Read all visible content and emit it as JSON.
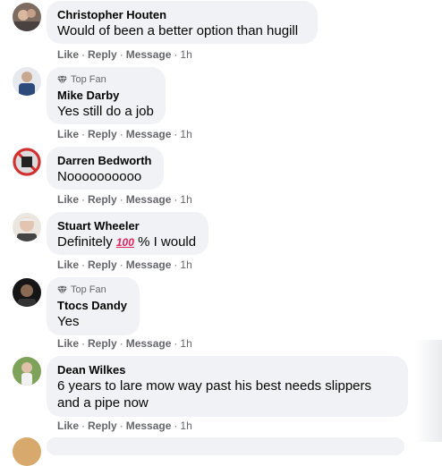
{
  "comments": [
    {
      "author": "Christopher Houten",
      "text": "Would of been a better option than hugill",
      "top_fan": false,
      "like": "Like",
      "reply": "Reply",
      "message": "Message",
      "time": "1h",
      "avatar_color": "#8a6a55"
    },
    {
      "author": "Mike Darby",
      "text": "Yes still do a job",
      "top_fan": true,
      "badge_label": "Top Fan",
      "like": "Like",
      "reply": "Reply",
      "message": "Message",
      "time": "1h",
      "avatar_color": "#3b5f86"
    },
    {
      "author": "Darren Bedworth",
      "text": "Noooooooooo",
      "top_fan": false,
      "like": "Like",
      "reply": "Reply",
      "message": "Message",
      "time": "1h",
      "avatar_color": "#2a2a2a"
    },
    {
      "author": "Stuart Wheeler",
      "text_before": "Definitely",
      "emoji": "100",
      "text_after": "% I would",
      "top_fan": false,
      "like": "Like",
      "reply": "Reply",
      "message": "Message",
      "time": "1h",
      "avatar_color": "#b9a89a"
    },
    {
      "author": "Ttocs Dandy",
      "text": "Yes",
      "top_fan": true,
      "badge_label": "Top Fan",
      "like": "Like",
      "reply": "Reply",
      "message": "Message",
      "time": "1h",
      "avatar_color": "#1f1f1f"
    },
    {
      "author": "Dean Wilkes",
      "text_line1": "6 years to lare mow way past his best needs slippers",
      "text_line2": "and a pipe now",
      "top_fan": false,
      "like": "Like",
      "reply": "Reply",
      "message": "Message",
      "time": "1h",
      "avatar_color": "#6b8a4e"
    }
  ],
  "colors": {
    "bubble": "#f0f2f5",
    "meta_text": "#65676b",
    "body_text": "#050505"
  }
}
